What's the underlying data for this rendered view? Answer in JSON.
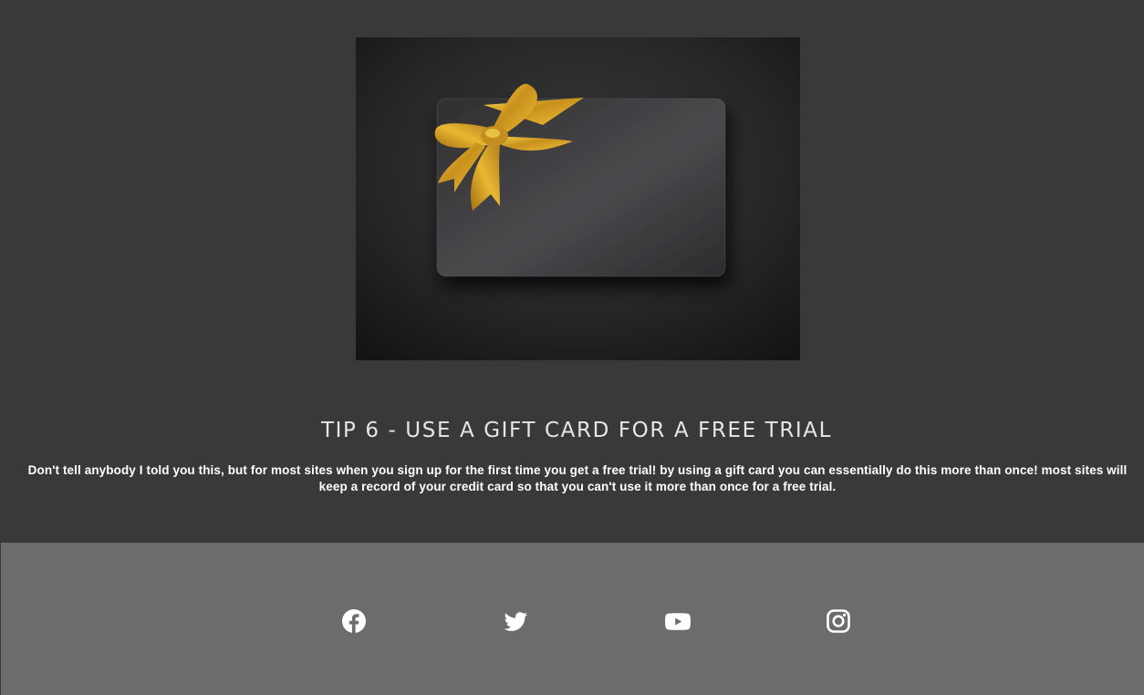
{
  "tip": {
    "title": "TIP 6 - USE A GIFT CARD FOR A FREE TRIAL",
    "body": "Don't tell anybody I told you this, but for most sites when you sign up for the first time you get a free trial! by using a gift card you can essentially do this more than once! most sites will keep a record of your credit card so that you can't use it more than once for a free trial."
  },
  "hero": {
    "icon": "gift-card-image"
  },
  "footer": {
    "social": [
      {
        "name": "facebook",
        "icon": "facebook-icon"
      },
      {
        "name": "twitter",
        "icon": "twitter-icon"
      },
      {
        "name": "youtube",
        "icon": "youtube-icon"
      },
      {
        "name": "instagram",
        "icon": "instagram-icon"
      }
    ]
  },
  "colors": {
    "background": "#393939",
    "footer": "#6c6c6c",
    "ribbon_gold": "#d9a72a",
    "card": "#3a3a3c"
  }
}
